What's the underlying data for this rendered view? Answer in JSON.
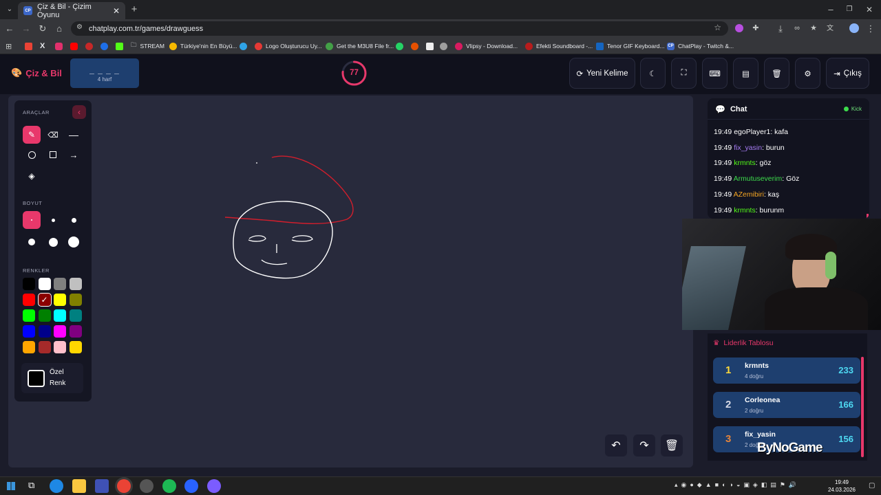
{
  "browser": {
    "tab_title": "Çiz & Bil - Çizim Oyunu",
    "tab_favicon": "CP",
    "url": "chatplay.com.tr/games/drawguess",
    "bookmarks": [
      "STREAM",
      "Türkiye'nin En Büyü...",
      "Logo Oluşturucu Uy...",
      "Get the M3U8 File fr...",
      "Vlipsy - Download...",
      "Efekti Soundboard -...",
      "Tenor GIF Keyboard...",
      "ChatPlay - Twitch &..."
    ]
  },
  "header": {
    "logo": "Çiz & Bil",
    "word_mask": "_ _ _ _",
    "word_hint": "4 harf",
    "timer": "77",
    "timer_progress": 0.77,
    "new_word_label": "Yeni Kelime",
    "exit_label": "Çıkış"
  },
  "tools": {
    "tools_title": "ARAÇLAR",
    "size_title": "BOYUT",
    "colors_title": "RENKLER",
    "custom_label_1": "Özel",
    "custom_label_2": "Renk",
    "colors": [
      "#000000",
      "#ffffff",
      "#808080",
      "#c0c0c0",
      "#ff0000",
      "#8b0000",
      "#ffff00",
      "#808000",
      "#00ff00",
      "#008000",
      "#00ffff",
      "#008080",
      "#0000ff",
      "#00008b",
      "#ff00ff",
      "#800080",
      "#ffa500",
      "#a52a2a",
      "#ffc0cb",
      "#ffd700"
    ],
    "accent": "#e8386b"
  },
  "chat": {
    "title": "Chat",
    "kick_label": "Kick",
    "messages": [
      {
        "time": "19:49",
        "user": "egoPlayer1",
        "color": "#ffffff",
        "text": ": kafa"
      },
      {
        "time": "19:49",
        "user": "fix_yasin",
        "color": "#a77df5",
        "text": ": burun"
      },
      {
        "time": "19:49",
        "user": "krmnts",
        "color": "#53fc18",
        "text": ": göz"
      },
      {
        "time": "19:49",
        "user": "Armutuseverim",
        "color": "#3ddc4c",
        "text": ": Göz"
      },
      {
        "time": "19:49",
        "user": "AZemibiri",
        "color": "#f5a623",
        "text": ": kaş"
      },
      {
        "time": "19:49",
        "user": "krmnts",
        "color": "#53fc18",
        "text": ": burunm"
      }
    ]
  },
  "leaderboard": {
    "title": "Liderlik Tablosu",
    "entries": [
      {
        "rank": "1",
        "name": "krmnts",
        "sub": "4 doğru",
        "score": "233",
        "rank_color": "#ffd93b"
      },
      {
        "rank": "2",
        "name": "Corleonea",
        "sub": "2 doğru",
        "score": "166",
        "rank_color": "#d6d9e6"
      },
      {
        "rank": "3",
        "name": "fix_yasin",
        "sub": "2 doğru",
        "score": "156",
        "rank_color": "#e3843c"
      }
    ]
  },
  "overlay": {
    "watermark": "ByNoGame"
  },
  "taskbar": {
    "time": "19:49",
    "date": "24.03.2026"
  }
}
